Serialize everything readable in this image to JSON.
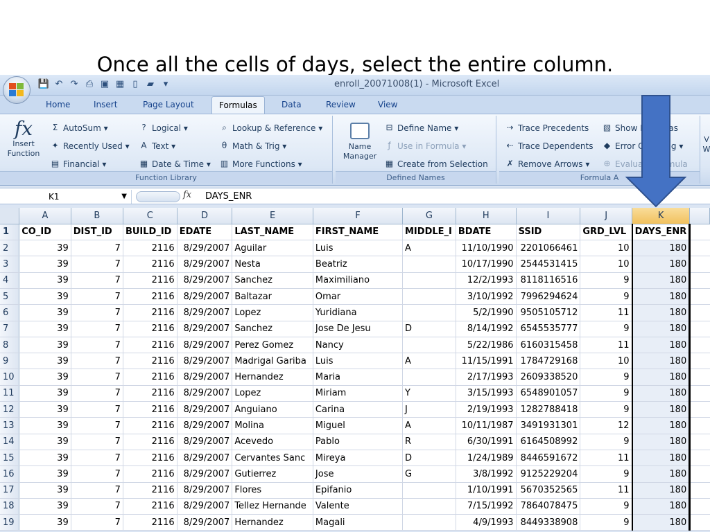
{
  "slide": {
    "title": "Once all the cells of days, select the entire column."
  },
  "window": {
    "title": "enroll_20071008(1) - Microsoft Excel"
  },
  "quick_access": [
    "save-icon",
    "undo-icon",
    "redo-icon",
    "print-icon",
    "print-preview-icon",
    "spelling-icon",
    "new-icon",
    "open-icon",
    "customize-icon"
  ],
  "tabs": [
    {
      "label": "Home"
    },
    {
      "label": "Insert"
    },
    {
      "label": "Page Layout"
    },
    {
      "label": "Formulas",
      "active": true
    },
    {
      "label": "Data"
    },
    {
      "label": "Review"
    },
    {
      "label": "View"
    }
  ],
  "ribbon": {
    "function_library": {
      "label": "Function Library",
      "insert_function_line1": "Insert",
      "insert_function_line2": "Function",
      "autosum": "AutoSum ▾",
      "recently_used": "Recently Used ▾",
      "financial": "Financial ▾",
      "logical": "Logical ▾",
      "text": "Text ▾",
      "date_time": "Date & Time ▾",
      "lookup": "Lookup & Reference ▾",
      "math_trig": "Math & Trig ▾",
      "more_functions": "More Functions ▾"
    },
    "defined_names": {
      "label": "Defined Names",
      "name_manager_line1": "Name",
      "name_manager_line2": "Manager",
      "define_name": "Define Name ▾",
      "use_in_formula": "Use in Formula ▾",
      "create_from_selection": "Create from Selection"
    },
    "formula_auditing": {
      "label": "Formula A",
      "trace_precedents": "Trace Precedents",
      "trace_dependents": "Trace Dependents",
      "remove_arrows": "Remove Arrows ▾",
      "show_formulas": "Show Formulas",
      "error_checking": "Error Checking ▾",
      "evaluate_formula": "Evaluate Formula"
    },
    "watch_partial_line1": "V",
    "watch_partial_line2": "W"
  },
  "formula_bar": {
    "name_box": "K1",
    "fx": "fx",
    "content": "DAYS_ENR"
  },
  "sheet": {
    "columns": [
      "A",
      "B",
      "C",
      "D",
      "E",
      "F",
      "G",
      "H",
      "I",
      "J",
      "K"
    ],
    "selected_column": "K",
    "headers": [
      "CO_ID",
      "DIST_ID",
      "BUILD_ID",
      "EDATE",
      "LAST_NAME",
      "FIRST_NAME",
      "MIDDLE_I",
      "BDATE",
      "SSID",
      "GRD_LVL",
      "DAYS_ENR"
    ],
    "rows": [
      [
        "39",
        "7",
        "2116",
        "8/29/2007",
        "Aguilar",
        "Luis",
        "A",
        "11/10/1990",
        "2201066461",
        "10",
        "180"
      ],
      [
        "39",
        "7",
        "2116",
        "8/29/2007",
        "Nesta",
        "Beatriz",
        "",
        "10/17/1990",
        "2544531415",
        "10",
        "180"
      ],
      [
        "39",
        "7",
        "2116",
        "8/29/2007",
        "Sanchez",
        "Maximiliano",
        "",
        "12/2/1993",
        "8118116516",
        "9",
        "180"
      ],
      [
        "39",
        "7",
        "2116",
        "8/29/2007",
        "Baltazar",
        "Omar",
        "",
        "3/10/1992",
        "7996294624",
        "9",
        "180"
      ],
      [
        "39",
        "7",
        "2116",
        "8/29/2007",
        "Lopez",
        "Yuridiana",
        "",
        "5/2/1990",
        "9505105712",
        "11",
        "180"
      ],
      [
        "39",
        "7",
        "2116",
        "8/29/2007",
        "Sanchez",
        "Jose De Jesu",
        "D",
        "8/14/1992",
        "6545535777",
        "9",
        "180"
      ],
      [
        "39",
        "7",
        "2116",
        "8/29/2007",
        "Perez Gomez",
        "Nancy",
        "",
        "5/22/1986",
        "6160315458",
        "11",
        "180"
      ],
      [
        "39",
        "7",
        "2116",
        "8/29/2007",
        "Madrigal Gariba",
        "Luis",
        "A",
        "11/15/1991",
        "1784729168",
        "10",
        "180"
      ],
      [
        "39",
        "7",
        "2116",
        "8/29/2007",
        "Hernandez",
        "Maria",
        "",
        "2/17/1993",
        "2609338520",
        "9",
        "180"
      ],
      [
        "39",
        "7",
        "2116",
        "8/29/2007",
        "Lopez",
        "Miriam",
        "Y",
        "3/15/1993",
        "6548901057",
        "9",
        "180"
      ],
      [
        "39",
        "7",
        "2116",
        "8/29/2007",
        "Anguiano",
        "Carina",
        "J",
        "2/19/1993",
        "1282788418",
        "9",
        "180"
      ],
      [
        "39",
        "7",
        "2116",
        "8/29/2007",
        "Molina",
        "Miguel",
        "A",
        "10/11/1987",
        "3491931301",
        "12",
        "180"
      ],
      [
        "39",
        "7",
        "2116",
        "8/29/2007",
        "Acevedo",
        "Pablo",
        "R",
        "6/30/1991",
        "6164508992",
        "9",
        "180"
      ],
      [
        "39",
        "7",
        "2116",
        "8/29/2007",
        "Cervantes Sanc",
        "Mireya",
        "D",
        "1/24/1989",
        "8446591672",
        "11",
        "180"
      ],
      [
        "39",
        "7",
        "2116",
        "8/29/2007",
        "Gutierrez",
        "Jose",
        "G",
        "3/8/1992",
        "9125229204",
        "9",
        "180"
      ],
      [
        "39",
        "7",
        "2116",
        "8/29/2007",
        "Flores",
        "Epifanio",
        "",
        "1/10/1991",
        "5670352565",
        "11",
        "180"
      ],
      [
        "39",
        "7",
        "2116",
        "8/29/2007",
        "Tellez Hernande",
        "Valente",
        "",
        "7/15/1992",
        "7864078475",
        "9",
        "180"
      ],
      [
        "39",
        "7",
        "2116",
        "8/29/2007",
        "Hernandez",
        "Magali",
        "",
        "4/9/1993",
        "8449338908",
        "9",
        "180"
      ]
    ]
  },
  "colors": {
    "annotation_arrow": "#4472c4",
    "selected_header": "#f1c15e",
    "selected_column": "#e8eef7"
  }
}
